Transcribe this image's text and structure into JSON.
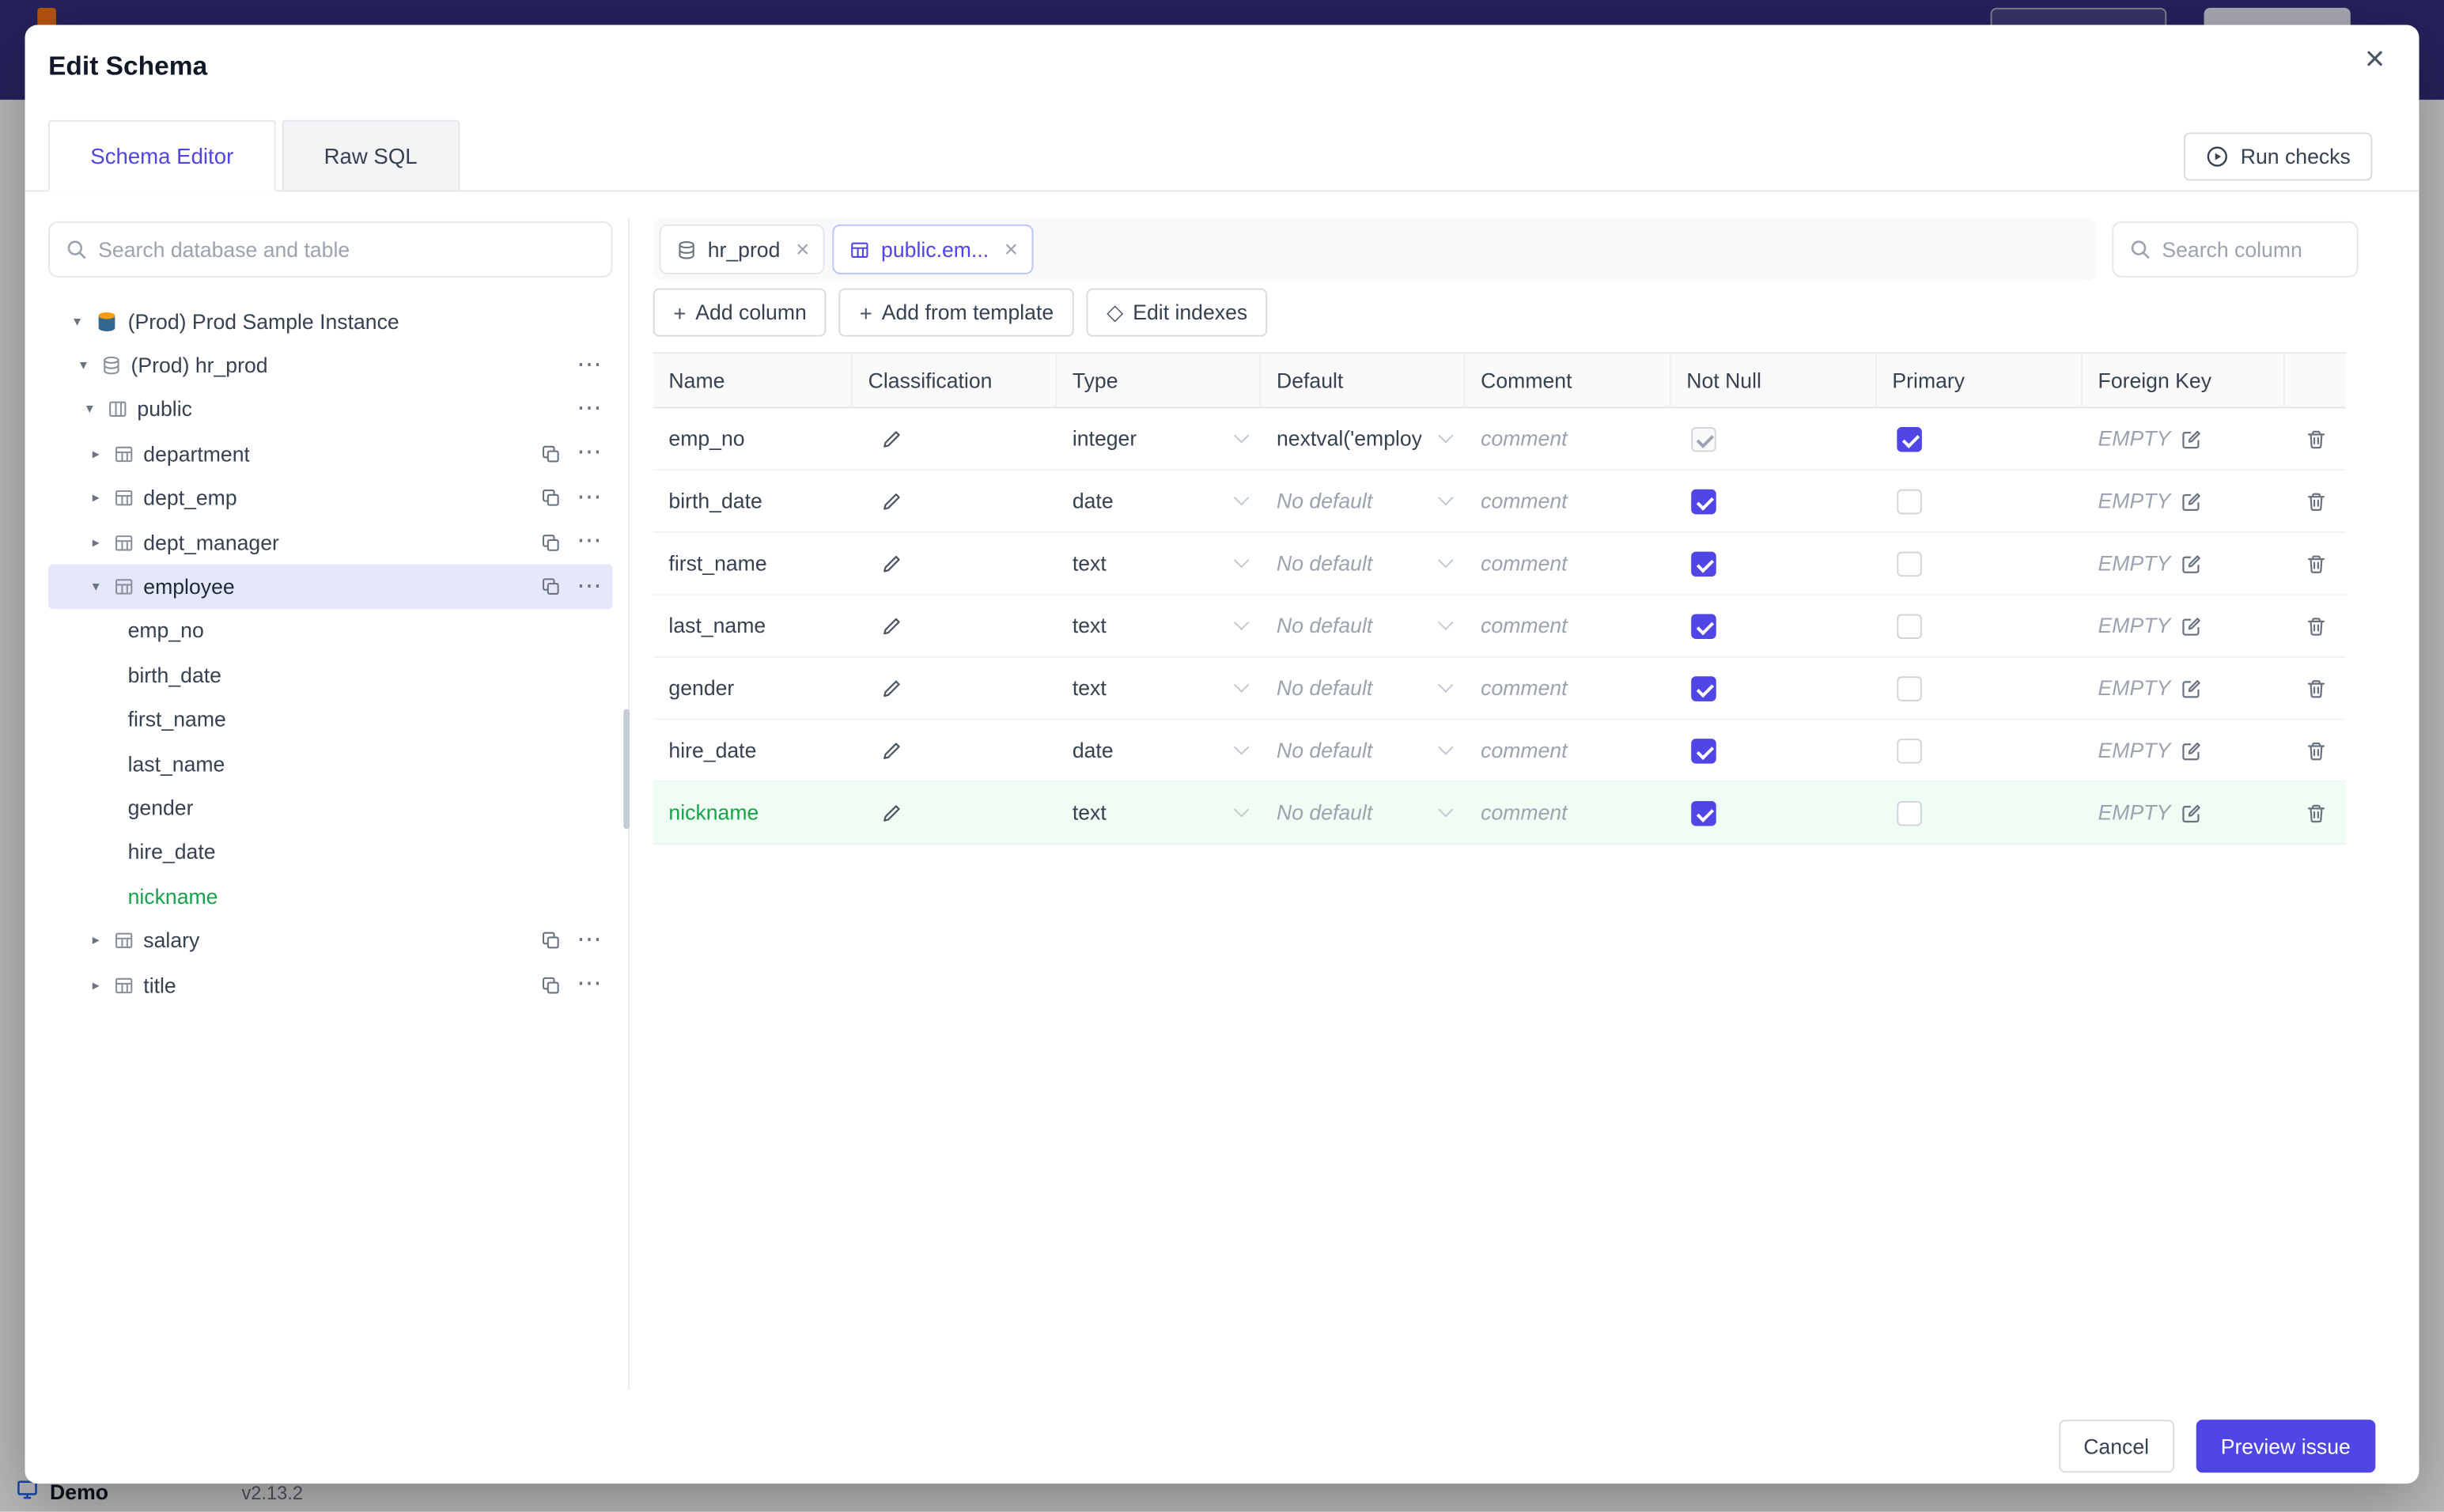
{
  "background": {
    "demo_label": "Demo",
    "version": "v2.13.2"
  },
  "icons": {
    "caret_down": "▾",
    "caret_right": "▸",
    "menu_dots": "⋯",
    "close": "×",
    "plus": "+",
    "diamond": "◇"
  },
  "modal": {
    "title": "Edit Schema",
    "tabs": [
      {
        "label": "Schema Editor",
        "active": true
      },
      {
        "label": "Raw SQL",
        "active": false
      }
    ],
    "run_checks_label": "Run checks",
    "footer": {
      "cancel_label": "Cancel",
      "preview_label": "Preview issue"
    }
  },
  "sidebar": {
    "search_placeholder": "Search database and table",
    "tree": [
      {
        "label": "(Prod) Prod Sample Instance"
      },
      {
        "label": "(Prod) hr_prod"
      },
      {
        "label": "public"
      },
      {
        "label": "department"
      },
      {
        "label": "dept_emp"
      },
      {
        "label": "dept_manager"
      },
      {
        "label": "employee",
        "selected": true
      },
      {
        "label": "emp_no"
      },
      {
        "label": "birth_date"
      },
      {
        "label": "first_name"
      },
      {
        "label": "last_name"
      },
      {
        "label": "gender"
      },
      {
        "label": "hire_date"
      },
      {
        "label": "nickname",
        "is_new": true
      },
      {
        "label": "salary"
      },
      {
        "label": "title"
      }
    ]
  },
  "editor": {
    "chips": [
      {
        "label": "hr_prod",
        "active": false
      },
      {
        "label": "public.em...",
        "active": true
      }
    ],
    "search_placeholder": "Search column",
    "actions": {
      "add_column": "Add column",
      "add_from_template": "Add from template",
      "edit_indexes": "Edit indexes"
    },
    "table": {
      "headers": [
        "Name",
        "Classification",
        "Type",
        "Default",
        "Comment",
        "Not Null",
        "Primary",
        "Foreign Key"
      ],
      "comment_placeholder": "comment",
      "empty_label": "EMPTY",
      "rows": [
        {
          "name": "emp_no",
          "type": "integer",
          "default": "nextval('employ",
          "default_placeholder": false,
          "not_null": true,
          "not_null_muted": true,
          "primary": true,
          "is_new": false
        },
        {
          "name": "birth_date",
          "type": "date",
          "default": "No default",
          "default_placeholder": true,
          "not_null": true,
          "not_null_muted": false,
          "primary": false,
          "is_new": false
        },
        {
          "name": "first_name",
          "type": "text",
          "default": "No default",
          "default_placeholder": true,
          "not_null": true,
          "not_null_muted": false,
          "primary": false,
          "is_new": false
        },
        {
          "name": "last_name",
          "type": "text",
          "default": "No default",
          "default_placeholder": true,
          "not_null": true,
          "not_null_muted": false,
          "primary": false,
          "is_new": false
        },
        {
          "name": "gender",
          "type": "text",
          "default": "No default",
          "default_placeholder": true,
          "not_null": true,
          "not_null_muted": false,
          "primary": false,
          "is_new": false
        },
        {
          "name": "hire_date",
          "type": "date",
          "default": "No default",
          "default_placeholder": true,
          "not_null": true,
          "not_null_muted": false,
          "primary": false,
          "is_new": false
        },
        {
          "name": "nickname",
          "type": "text",
          "default": "No default",
          "default_placeholder": true,
          "not_null": true,
          "not_null_muted": false,
          "primary": false,
          "is_new": true
        }
      ]
    }
  },
  "colors": {
    "primary": "#4f46e5",
    "new_column_green": "#16a34a",
    "selected_row_bg": "#e5e8fc",
    "new_row_bg": "#f0fdf4",
    "topbar_bg": "#34307e"
  }
}
